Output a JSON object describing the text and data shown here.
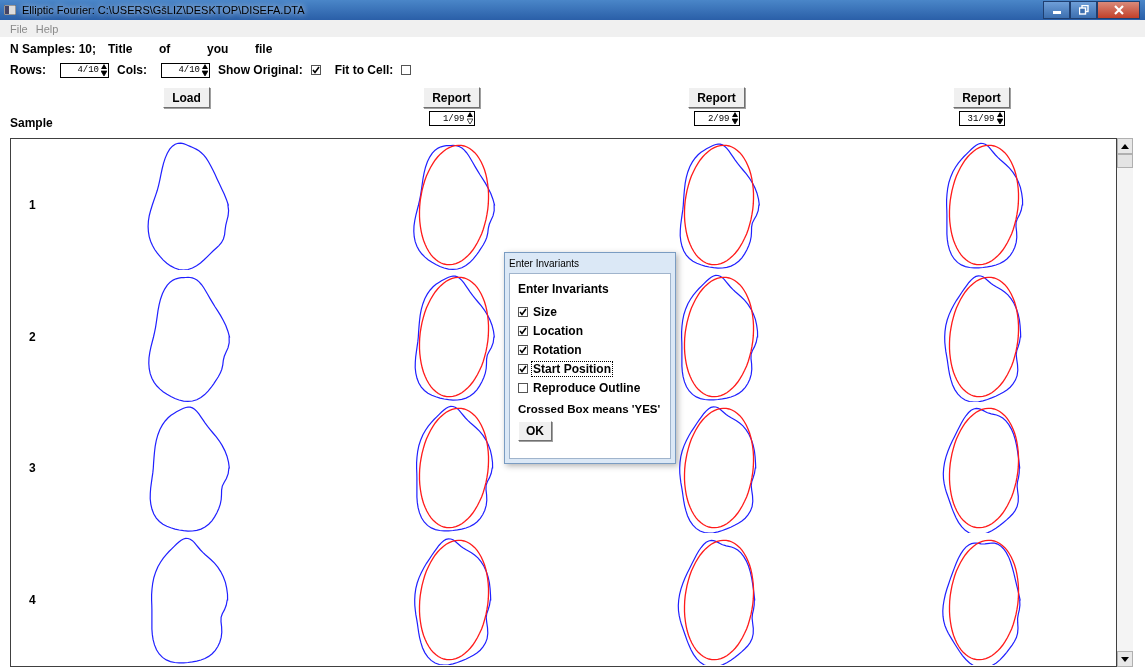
{
  "window": {
    "title": "Elliptic Fourier: C:\\USERS\\GšLIZ\\DESKTOP\\DISEFA.DTA"
  },
  "menu": [
    {
      "label": "File",
      "disabled": true
    },
    {
      "label": "Help",
      "disabled": true
    }
  ],
  "info": [
    "N Samples: 10;",
    "Title",
    "of",
    "you",
    "file"
  ],
  "controls": {
    "rows_label": "Rows:",
    "rows_value": "4/10",
    "cols_label": "Cols:",
    "cols_value": "4/10",
    "show_original": {
      "label": "Show Original:",
      "checked": true
    },
    "fit_to_cell": {
      "label": "Fit to Cell:",
      "checked": false
    }
  },
  "sample_label": "Sample",
  "columns": [
    {
      "kind": "original",
      "button": "Load"
    },
    {
      "kind": "fit",
      "button": "Report",
      "sample": "1/99"
    },
    {
      "kind": "fit",
      "button": "Report",
      "sample": "2/99"
    },
    {
      "kind": "fit",
      "button": "Report",
      "sample": "31/99"
    }
  ],
  "rows": [
    "1",
    "2",
    "3",
    "4"
  ],
  "dialog": {
    "title": "Enter Invariants",
    "heading": "Enter Invariants",
    "options": [
      {
        "label": "Size",
        "checked": true,
        "focused": false
      },
      {
        "label": "Location",
        "checked": true,
        "focused": false
      },
      {
        "label": "Rotation",
        "checked": true,
        "focused": false
      },
      {
        "label": "Start Position",
        "checked": true,
        "focused": true
      },
      {
        "label": "Reproduce Outline",
        "checked": false,
        "focused": false
      }
    ],
    "note": "Crossed Box means 'YES'",
    "ok": "OK"
  }
}
